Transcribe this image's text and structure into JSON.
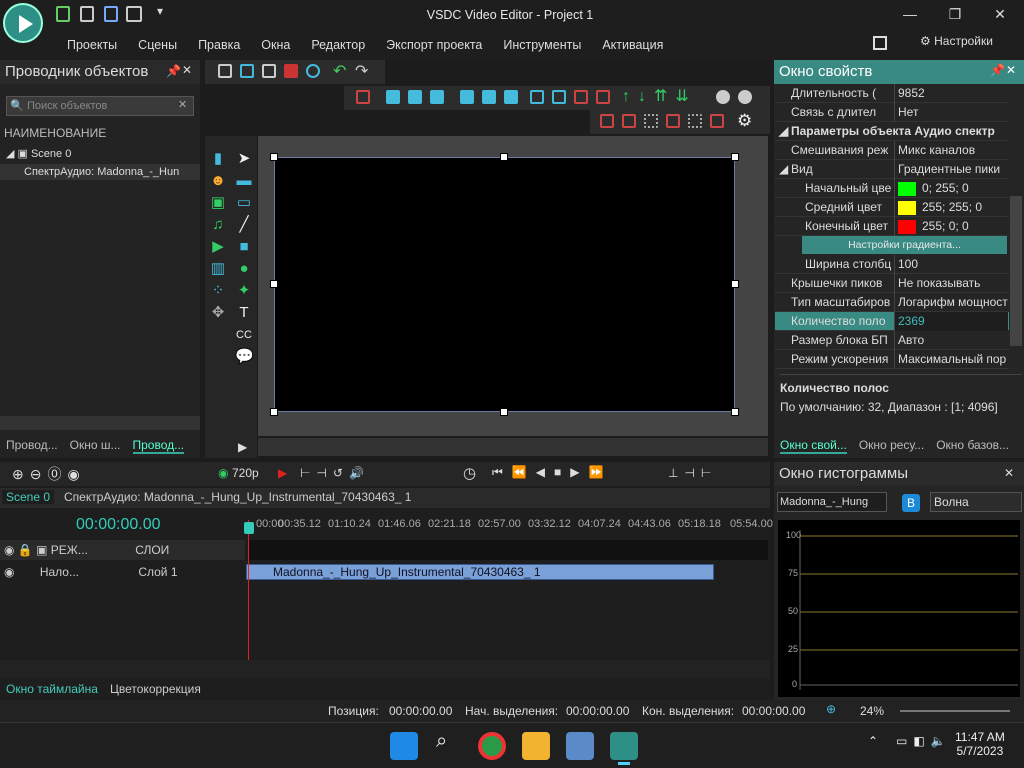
{
  "window": {
    "title": "VSDC Video Editor - Project 1"
  },
  "menu": [
    "Проекты",
    "Сцены",
    "Правка",
    "Окна",
    "Редактор",
    "Экспорт проекта",
    "Инструменты",
    "Активация"
  ],
  "settings_label": "Настройки",
  "left_panel": {
    "title": "Проводник объектов",
    "search_placeholder": "Поиск объектов",
    "column": "НАИМЕНОВАНИЕ",
    "tree": [
      "Scene 0",
      "СпектрАудио: Madonna_-_Hun"
    ],
    "tabs": [
      "Провод...",
      "Окно ш...",
      "Провод..."
    ]
  },
  "properties": {
    "title": "Окно свойств",
    "rows": [
      {
        "k": "Длительность (",
        "v": "9852"
      },
      {
        "k": "Связь с длител",
        "v": "Нет"
      },
      {
        "k": "Параметры объекта Аудио спектр",
        "v": ""
      },
      {
        "k": "Смешивания реж",
        "v": "Микс каналов"
      },
      {
        "k": "Вид",
        "v": "Градиентные пики"
      },
      {
        "k": "Начальный цве",
        "v": "0; 255; 0",
        "color": "#00ff00"
      },
      {
        "k": "Средний цвет",
        "v": "255; 255; 0",
        "color": "#ffff00"
      },
      {
        "k": "Конечный цвет",
        "v": "255; 0; 0",
        "color": "#ff0000"
      },
      {
        "k": "Ширина столбц",
        "v": "100"
      },
      {
        "k": "Крышечки пиков",
        "v": "Не показывать"
      },
      {
        "k": "Тип масштабиров",
        "v": "Логарифм мощност"
      },
      {
        "k": "Количество поло",
        "v": "2369"
      },
      {
        "k": "Размер блока БП",
        "v": "Авто"
      },
      {
        "k": "Режим ускорения",
        "v": "Максимальный пор"
      }
    ],
    "gradient_button": "Настройки градиента...",
    "desc_title": "Количество полос",
    "desc_text": "По умолчанию: 32, Диапазон : [1; 4096]",
    "tabs": [
      "Окно свой...",
      "Окно ресу...",
      "Окно базов..."
    ]
  },
  "histogram": {
    "title": "Окно гистограммы",
    "source": "Madonna_-_Hung",
    "mode": "Волна",
    "b_label": "B",
    "y_ticks": [
      "100",
      "75",
      "50",
      "25",
      "0"
    ]
  },
  "timeline": {
    "resolution": "720p",
    "scene_tab": "Scene 0",
    "clip_tab": "СпектрАудио: Madonna_-_Hung_Up_Instrumental_70430463_ 1",
    "time": "00:00:00.00",
    "ruler": [
      "00:00",
      "00:35.12",
      "01:10.24",
      "01:46.06",
      "02:21.18",
      "02:57.00",
      "03:32.12",
      "04:07.24",
      "04:43.06",
      "05:18.18",
      "05:54.00"
    ],
    "layers_label": "СЛОИ",
    "mode_label": "РЕЖ...",
    "track_mode": "Нало...",
    "track_name": "Слой 1",
    "clip_name": "Madonna_-_Hung_Up_Instrumental_70430463_ 1"
  },
  "bottom_tabs": [
    "Окно таймлайна",
    "Цветокоррекция"
  ],
  "status": {
    "pos_label": "Позиция:",
    "pos": "00:00:00.00",
    "start_label": "Нач. выделения:",
    "start": "00:00:00.00",
    "end_label": "Кон. выделения:",
    "end": "00:00:00.00",
    "zoom": "24%"
  },
  "taskbar": {
    "time": "11:47 AM",
    "date": "5/7/2023"
  }
}
